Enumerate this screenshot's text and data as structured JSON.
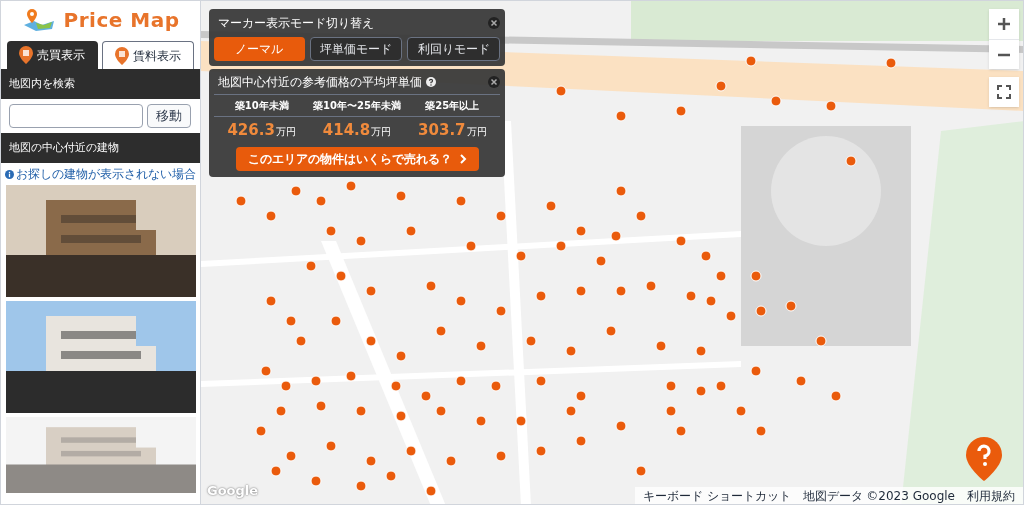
{
  "app": {
    "logo_text": "Price Map"
  },
  "tabs": [
    {
      "label": "売買表示",
      "selected": true
    },
    {
      "label": "賃料表示",
      "selected": false
    }
  ],
  "search": {
    "heading": "地図内を検索",
    "button": "移動"
  },
  "nearby": {
    "heading": "地図の中心付近の建物",
    "help_link": "お探しの建物が表示されない場合"
  },
  "mode_panel": {
    "title": "マーカー表示モード切り替え",
    "modes": [
      {
        "label": "ノーマル",
        "selected": true
      },
      {
        "label": "坪単価モード",
        "selected": false
      },
      {
        "label": "利回りモード",
        "selected": false
      }
    ]
  },
  "price_panel": {
    "title": "地図中心付近の参考価格の平均坪単価",
    "columns": [
      {
        "label": "築10年未満",
        "value": "426.3",
        "unit": "万円"
      },
      {
        "label": "築10年〜25年未満",
        "value": "414.8",
        "unit": "万円"
      },
      {
        "label": "築25年以上",
        "value": "303.7",
        "unit": "万円"
      }
    ],
    "cta": "このエリアの物件はいくらで売れる？"
  },
  "attribution": {
    "logo": "Google",
    "shortcuts": "キーボード ショートカット",
    "map_data": "地図データ ©2023 Google",
    "terms": "利用規約"
  }
}
